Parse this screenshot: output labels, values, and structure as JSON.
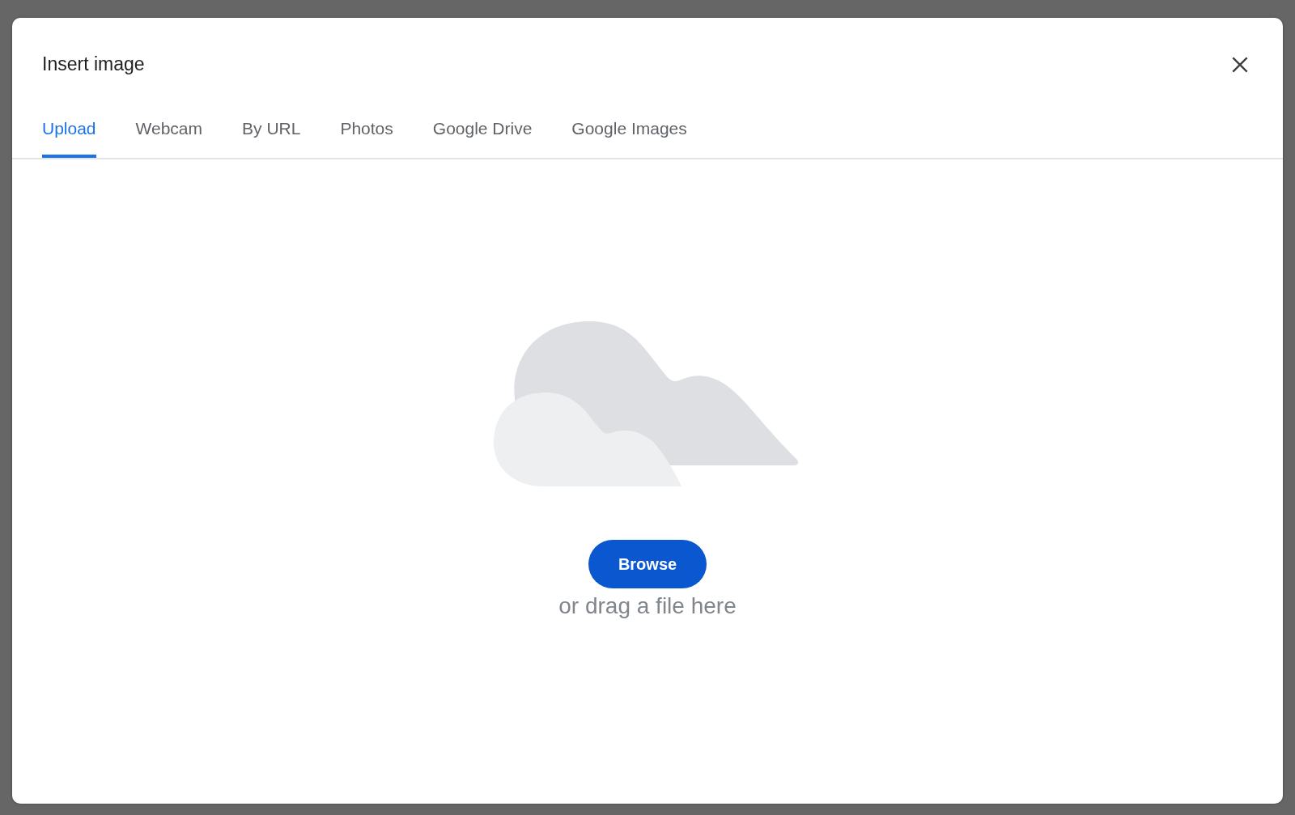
{
  "dialog": {
    "title": "Insert image"
  },
  "tabs": [
    {
      "label": "Upload",
      "selected": true
    },
    {
      "label": "Webcam",
      "selected": false
    },
    {
      "label": "By URL",
      "selected": false
    },
    {
      "label": "Photos",
      "selected": false
    },
    {
      "label": "Google Drive",
      "selected": false
    },
    {
      "label": "Google Images",
      "selected": false
    }
  ],
  "upload": {
    "button": "Browse",
    "hint": "or drag a file here"
  }
}
